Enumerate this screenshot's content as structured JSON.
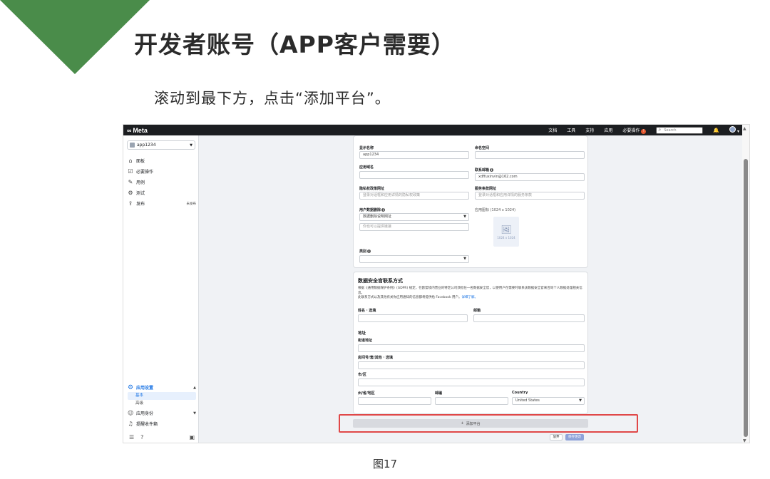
{
  "slide": {
    "title": "开发者账号（APP客户需要）",
    "subtitle": "滚动到最下方，点击“添加平台”。",
    "caption": "图17",
    "accent_color": "#4a8c4a"
  },
  "topbar": {
    "logo": "Meta",
    "nav": [
      "文档",
      "工具",
      "支持",
      "应用",
      "必要操作"
    ],
    "warn_count": "!",
    "search_placeholder": "Search"
  },
  "sidebar": {
    "app_name": "app1234",
    "items": [
      {
        "label": "面板",
        "icon": "dashboard-icon"
      },
      {
        "label": "必要操作",
        "icon": "checklist-icon"
      },
      {
        "label": "用例",
        "icon": "pencil-icon"
      },
      {
        "label": "测试",
        "icon": "test-icon"
      },
      {
        "label": "发布",
        "icon": "publish-icon",
        "badge": "未发布"
      }
    ],
    "settings": {
      "label": "应用设置",
      "sub": [
        "基本",
        "高级"
      ]
    },
    "extra": [
      {
        "label": "应用身份",
        "icon": "user-icon"
      },
      {
        "label": "提醒收件箱",
        "icon": "bell-icon"
      }
    ]
  },
  "form": {
    "display_name_label": "显示名称",
    "display_name_value": "app1234",
    "namespace_label": "命名空间",
    "app_domain_label": "应用域名",
    "contact_email_label": "联系邮箱",
    "contact_email_value": "xdffuxinvin@162.com",
    "privacy_label": "隐私权政策网址",
    "privacy_placeholder": "登录对话框和应用详情的隐私权政策",
    "tos_label": "服务条款网址",
    "tos_placeholder": "登录对话框和应用详情的服务条款",
    "user_data_label": "用户数据删除",
    "user_data_select": "数据删除说明网址",
    "user_data_placeholder": "你也可以提供链接",
    "app_icon_label": "应用图标 (1024 x 1024)",
    "app_icon_size": "1024 x 1024",
    "category_label": "类别"
  },
  "dpo": {
    "title": "数据安全官联系方式",
    "para1": "根据《通用数据保护条例》(GDPR) 规定，在欧盟境内营业的特定公司须指任一名数据安全官，以便用户在需要时联系该数据安全官来咨询个人数据处理相关信息。",
    "para2": "此联系方式以及其他有关你应用通知的信息都将提供给 Facebook 用户。",
    "learn_more": "详细了解。",
    "name_label": "姓名 · 选填",
    "email_label": "邮箱",
    "address_label": "地址",
    "street_label": "街道地址",
    "apt_label": "房间号/套/其他 · 选填",
    "city_label": "市/区",
    "state_label": "州/省/地区",
    "zip_label": "邮编",
    "country_label": "Country",
    "country_value": "United States"
  },
  "actions": {
    "add_platform": "添加平台",
    "discard": "放弃",
    "save": "保存更改"
  }
}
